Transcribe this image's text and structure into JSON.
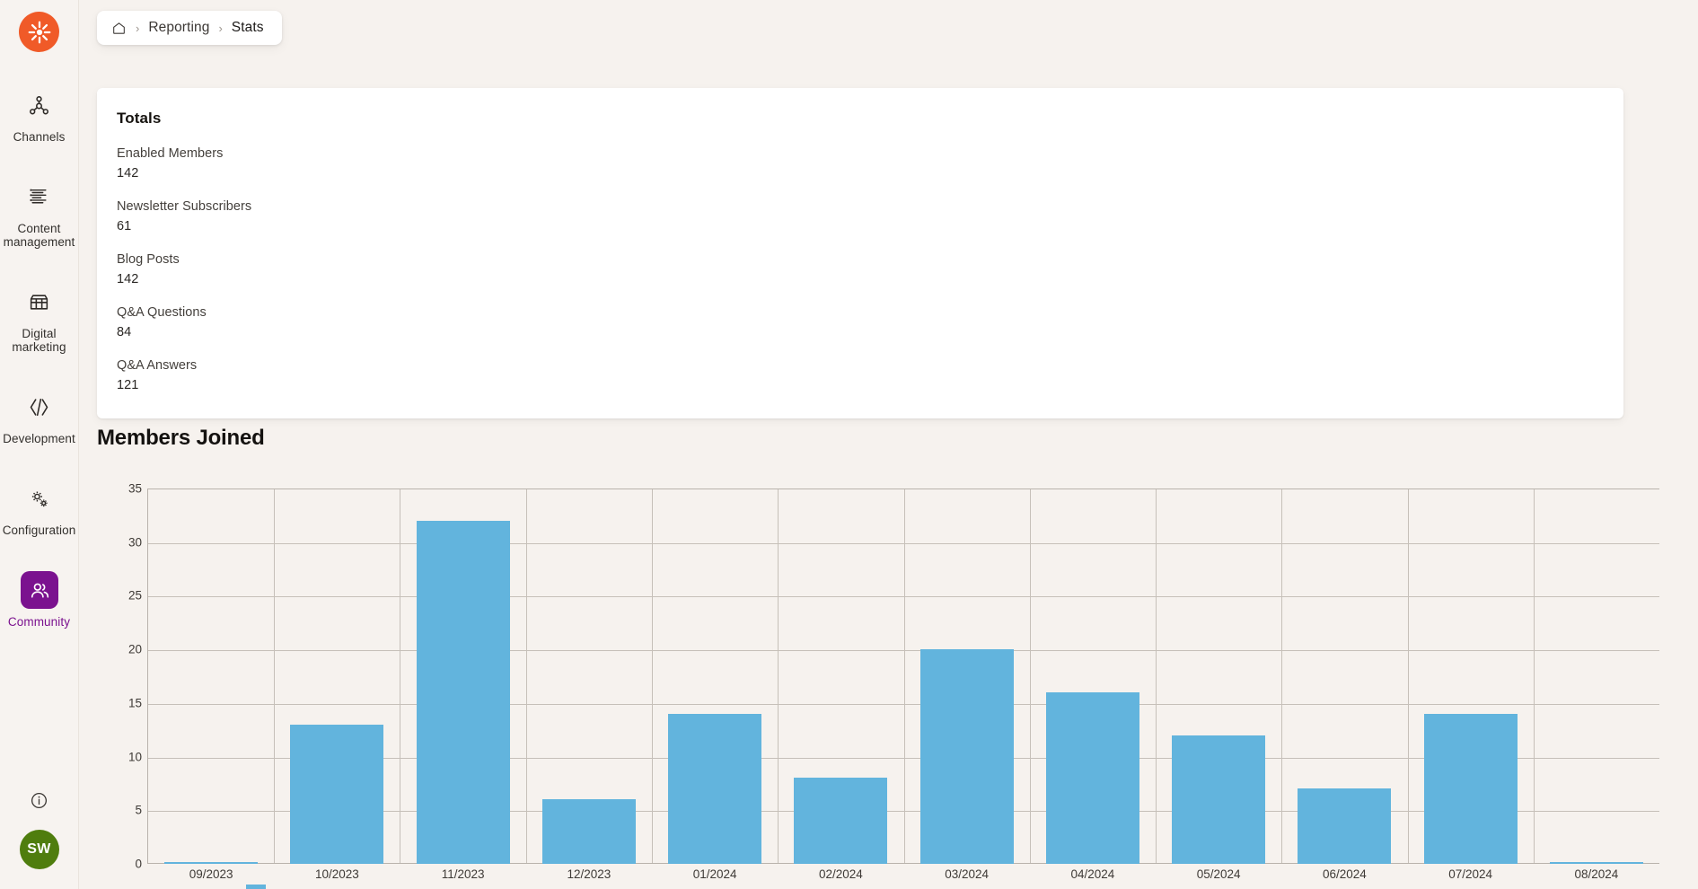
{
  "app": {
    "logo_icon": "kentico-asterisk-logo"
  },
  "sidebar": {
    "items": [
      {
        "label": "Channels",
        "icon": "channels-network-icon",
        "active": false
      },
      {
        "label": "Content management",
        "icon": "content-lines-icon",
        "active": false
      },
      {
        "label": "Digital marketing",
        "icon": "storefront-icon",
        "active": false
      },
      {
        "label": "Development",
        "icon": "code-brackets-icon",
        "active": false
      },
      {
        "label": "Configuration",
        "icon": "gears-icon",
        "active": false
      },
      {
        "label": "Community",
        "icon": "users-group-icon",
        "active": true
      }
    ],
    "info_icon": "info-circle-icon",
    "avatar_initials": "SW",
    "active_color": "#7b128f",
    "avatar_color": "#4f7d0e",
    "logo_color": "#f05a28"
  },
  "breadcrumb": {
    "home_icon": "home-icon",
    "separator": "›",
    "items": [
      "Reporting",
      "Stats"
    ]
  },
  "totals": {
    "title": "Totals",
    "stats": [
      {
        "label": "Enabled Members",
        "value": "142"
      },
      {
        "label": "Newsletter Subscribers",
        "value": "61"
      },
      {
        "label": "Blog Posts",
        "value": "142"
      },
      {
        "label": "Q&A Questions",
        "value": "84"
      },
      {
        "label": "Q&A Answers",
        "value": "121"
      }
    ]
  },
  "chart_data": {
    "type": "bar",
    "title": "Members Joined",
    "xlabel": "",
    "ylabel": "",
    "ylim": [
      0,
      35
    ],
    "yticks": [
      0,
      5,
      10,
      15,
      20,
      25,
      30,
      35
    ],
    "grid": true,
    "legend_position": "bottom",
    "series_color": "#62b4dd",
    "categories": [
      "09/2023",
      "10/2023",
      "11/2023",
      "12/2023",
      "01/2024",
      "02/2024",
      "03/2024",
      "04/2024",
      "05/2024",
      "06/2024",
      "07/2024",
      "08/2024"
    ],
    "values": [
      0,
      13,
      32,
      6,
      14,
      8,
      20,
      16,
      12,
      7,
      14,
      0
    ]
  }
}
